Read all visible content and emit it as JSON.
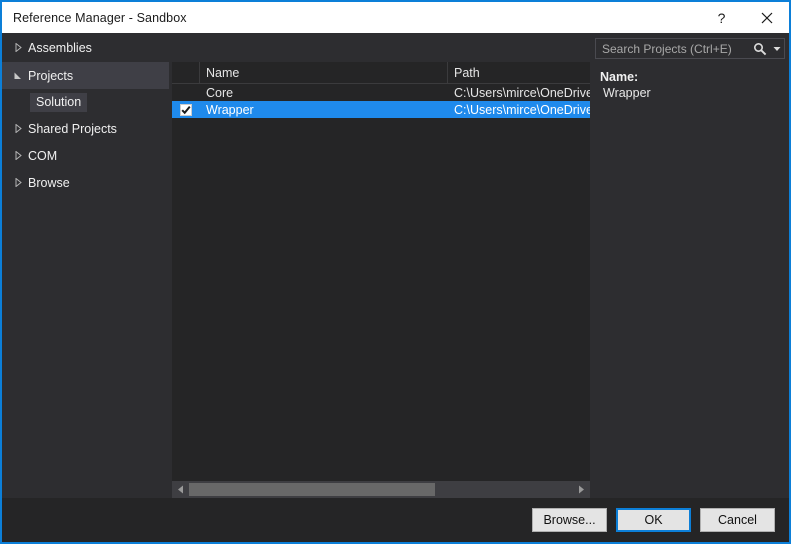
{
  "window": {
    "title": "Reference Manager - Sandbox",
    "help_label": "?",
    "close_label": "✕",
    "accent_color": "#0c7fd8",
    "selection_color": "#1f8aec",
    "titlebar_bg": "#ffffff",
    "body_bg": "#2d2d30",
    "list_bg": "#252526"
  },
  "sidebar": {
    "items": [
      {
        "label": "Assemblies",
        "state": "collapsed",
        "selected": false
      },
      {
        "label": "Projects",
        "state": "expanded",
        "selected": true
      },
      {
        "label": "Solution",
        "state": "child",
        "selected": true
      },
      {
        "label": "Shared Projects",
        "state": "collapsed",
        "selected": false
      },
      {
        "label": "COM",
        "state": "collapsed",
        "selected": false
      },
      {
        "label": "Browse",
        "state": "collapsed",
        "selected": false
      }
    ]
  },
  "search": {
    "placeholder": "Search Projects (Ctrl+E)",
    "value": "",
    "icon": "search-icon",
    "dropdown_icon": "chevron-down-icon"
  },
  "list": {
    "columns": [
      "",
      "Name",
      "Path"
    ],
    "rows": [
      {
        "checked": false,
        "name": "Core",
        "path": "C:\\Users\\mirce\\OneDrive",
        "selected": false
      },
      {
        "checked": true,
        "name": "Wrapper",
        "path": "C:\\Users\\mirce\\OneDrive",
        "selected": true
      }
    ],
    "scrollbar": {
      "left_arrow": "triangle-left-icon",
      "right_arrow": "triangle-right-icon",
      "thumb_fraction": "64%"
    }
  },
  "detail": {
    "name_label": "Name:",
    "name_value": "Wrapper"
  },
  "footer": {
    "browse_label": "Browse...",
    "ok_label": "OK",
    "cancel_label": "Cancel"
  }
}
